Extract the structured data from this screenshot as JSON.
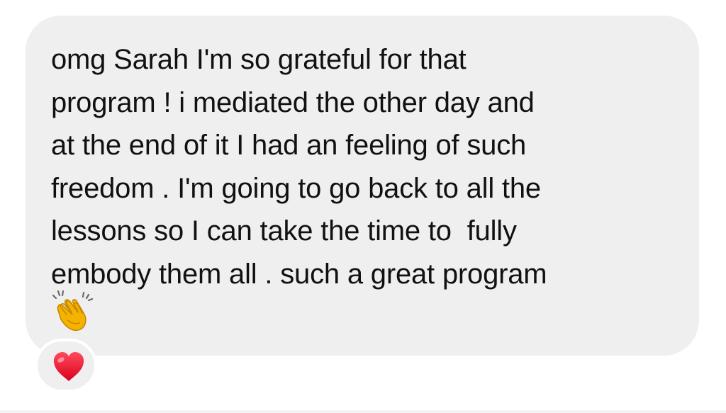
{
  "message": {
    "text": "omg Sarah I'm so grateful for that\nprogram ! i mediated the other day and\nat the end of it I had an feeling of such\nfreedom . I'm going to go back to all the\nlessons so I can take the time to  fully\nembody them all . such a great program",
    "trailing_emoji": "clapping-hands-icon"
  },
  "reaction": {
    "emoji": "red-heart-icon"
  },
  "colors": {
    "bubble_background": "#efefef",
    "text": "#111111",
    "heart": "#e8182f",
    "clap": "#f5b301"
  }
}
